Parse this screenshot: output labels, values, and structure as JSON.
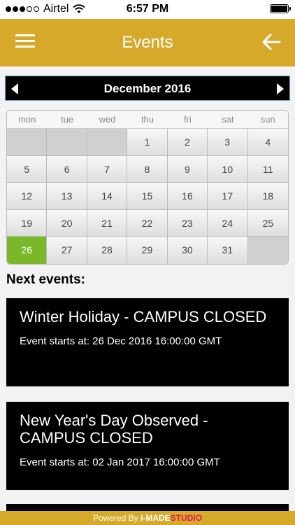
{
  "status": {
    "carrier": "Airtel",
    "time": "6:57 PM",
    "signal_bars": 5,
    "signal_filled": 3
  },
  "nav": {
    "title": "Events",
    "menu_icon": "hamburger-icon",
    "back_icon": "arrow-left-icon"
  },
  "calendar": {
    "month_label": "December 2016",
    "days_of_week": [
      "mon",
      "tue",
      "wed",
      "thu",
      "fri",
      "sat",
      "sun"
    ],
    "weeks": [
      [
        "",
        "",
        "",
        "1",
        "2",
        "3",
        "4"
      ],
      [
        "5",
        "6",
        "7",
        "8",
        "9",
        "10",
        "11"
      ],
      [
        "12",
        "13",
        "14",
        "15",
        "16",
        "17",
        "18"
      ],
      [
        "19",
        "20",
        "21",
        "22",
        "23",
        "24",
        "25"
      ],
      [
        "26",
        "27",
        "28",
        "29",
        "30",
        "31",
        ""
      ]
    ],
    "selected_day": "26",
    "accent_color": "#7ab82a"
  },
  "events_section": {
    "title": "Next events:"
  },
  "events": [
    {
      "title": "Winter Holiday - CAMPUS CLOSED",
      "time": "Event starts at: 26 Dec 2016 16:00:00 GMT"
    },
    {
      "title": "New Year's Day Observed - CAMPUS CLOSED",
      "time": "Event starts at: 02 Jan 2017 16:00:00 GMT"
    }
  ],
  "footer": {
    "powered_by": "Powered By",
    "brand": "I-MADE",
    "brand_studio": "STUDIO"
  },
  "colors": {
    "header": "#d6a92b",
    "brand_studio": "#e1195a"
  }
}
